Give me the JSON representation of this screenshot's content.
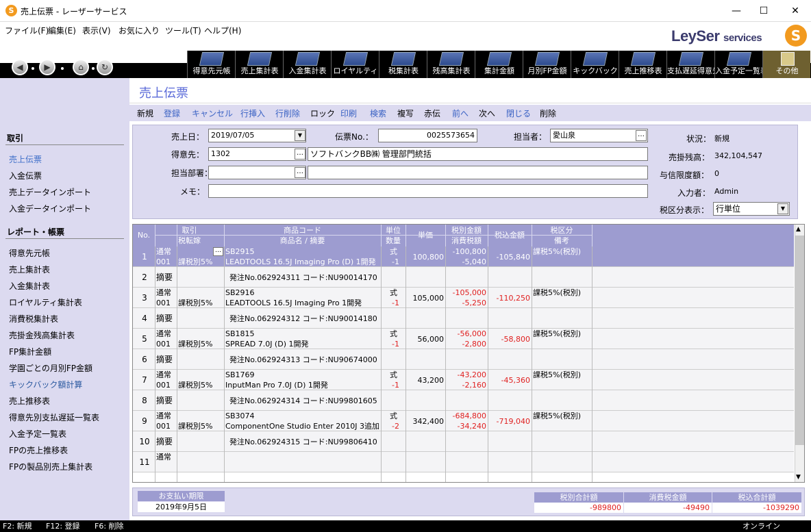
{
  "window": {
    "title": "売上伝票 - レーザーサービス",
    "app_icon": "S",
    "min": "—",
    "max": "☐",
    "close": "✕"
  },
  "menu": [
    "ファイル(F)",
    "編集(E)",
    "表示(V)",
    "お気に入り",
    "ツール(T)",
    "ヘルプ(H)"
  ],
  "logo": {
    "text": "LeySer",
    "suffix": "services",
    "mark": "S"
  },
  "nav": {
    "back": "◀",
    "forward": "▶",
    "home": "⌂",
    "refresh": "↻"
  },
  "toolbar": [
    "得意先元帳",
    "売上集計表",
    "入金集計表",
    "ロイヤルティ",
    "税集計表",
    "残高集計表",
    "集計金額",
    "月別FP金額",
    "キックバック",
    "売上推移表",
    "支払遅延得意先一覧",
    "入金予定一覧表",
    "その他"
  ],
  "sidebar": {
    "section1": "取引",
    "items1": [
      "売上伝票",
      "入金伝票",
      "売上データインポート",
      "入金データインポート"
    ],
    "section2": "レポート・帳票",
    "items2": [
      "得意先元帳",
      "売上集計表",
      "入金集計表",
      "ロイヤルティ集計表",
      "消費税集計表",
      "売掛金残高集計表",
      "FP集計金額",
      "学園ごとの月別FP金額",
      "キックバック額計算",
      "売上推移表",
      "得意先別支払遅延一覧表",
      "入金予定一覧表",
      "FPの売上推移表",
      "FPの製品別売上集計表"
    ]
  },
  "page_title": "売上伝票",
  "actions": [
    "新規",
    "登録",
    "キャンセル",
    "行挿入",
    "行削除",
    "ロック",
    "印刷",
    "検索",
    "複写",
    "赤伝",
    "前へ",
    "次へ",
    "閉じる",
    "削除"
  ],
  "form": {
    "sales_date_label": "売上日：",
    "sales_date": "2019/07/05",
    "slip_no_label": "伝票No.：",
    "slip_no": "0025573654",
    "staff_label": "担当者：",
    "staff": "愛山泉",
    "customer_label": "得意先：",
    "customer_code": "1302",
    "customer_name": "ソフトバンクBB㈱ 管理部門統括",
    "dept_label": "担当部署：",
    "dept_code": "",
    "dept_name": "",
    "memo_label": "メモ：",
    "memo": "",
    "status_label": "状況：",
    "status": "新規",
    "balance_label": "売掛残高：",
    "balance": "342,104,547",
    "credit_label": "与信限度額：",
    "credit": "0",
    "entered_by_label": "入力者：",
    "entered_by": "Admin",
    "tax_display_label": "税区分表示：",
    "tax_display": "行単位"
  },
  "grid": {
    "headers": {
      "no": "No.",
      "torihiki": "取引",
      "tenkan": "税転嫁",
      "code": "商品コード",
      "name": "商品名 / 摘要",
      "unit": "単位",
      "qty": "数量",
      "price": "単価",
      "excl": "税別金額",
      "tax": "消費税額",
      "incl": "税込金額",
      "taxcat": "税区分",
      "note": "備考"
    },
    "rows": [
      {
        "no": "1",
        "type": "item",
        "torihiki": "通常",
        "tcode": "001",
        "tenkan": "課税別5%",
        "code": "SB2915",
        "name": "LEADTOOLS 16.5J Imaging Pro (D) 1開発",
        "unit": "式",
        "qty": "-1",
        "price": "100,800",
        "excl": "-100,800",
        "tax": "-5,040",
        "incl": "-105,840",
        "taxcat": "課税5%(税別)"
      },
      {
        "no": "2",
        "type": "memo",
        "label": "摘要",
        "text": "発注No.062924311 コード:NU90014170"
      },
      {
        "no": "3",
        "type": "item",
        "torihiki": "通常",
        "tcode": "001",
        "tenkan": "課税別5%",
        "code": "SB2916",
        "name": "LEADTOOLS 16.5J Imaging Pro 1開発",
        "unit": "式",
        "qty": "-1",
        "price": "105,000",
        "excl": "-105,000",
        "tax": "-5,250",
        "incl": "-110,250",
        "taxcat": "課税5%(税別)"
      },
      {
        "no": "4",
        "type": "memo",
        "label": "摘要",
        "text": "発注No.062924312 コード:NU90014180"
      },
      {
        "no": "5",
        "type": "item",
        "torihiki": "通常",
        "tcode": "001",
        "tenkan": "課税別5%",
        "code": "SB1815",
        "name": "SPREAD 7.0J (D) 1開発",
        "unit": "式",
        "qty": "-1",
        "price": "56,000",
        "excl": "-56,000",
        "tax": "-2,800",
        "incl": "-58,800",
        "taxcat": "課税5%(税別)"
      },
      {
        "no": "6",
        "type": "memo",
        "label": "摘要",
        "text": "発注No.062924313 コード:NU90674000"
      },
      {
        "no": "7",
        "type": "item",
        "torihiki": "通常",
        "tcode": "001",
        "tenkan": "課税別5%",
        "code": "SB1769",
        "name": "InputMan Pro 7.0J (D) 1開発",
        "unit": "式",
        "qty": "-1",
        "price": "43,200",
        "excl": "-43,200",
        "tax": "-2,160",
        "incl": "-45,360",
        "taxcat": "課税5%(税別)"
      },
      {
        "no": "8",
        "type": "memo",
        "label": "摘要",
        "text": "発注No.062924314 コード:NU99801605"
      },
      {
        "no": "9",
        "type": "item",
        "torihiki": "通常",
        "tcode": "001",
        "tenkan": "課税別5%",
        "code": "SB3074",
        "name": "ComponentOne Studio Enter 2010J 3追加",
        "unit": "式",
        "qty": "-2",
        "price": "342,400",
        "excl": "-684,800",
        "tax": "-34,240",
        "incl": "-719,040",
        "taxcat": "課税5%(税別)"
      },
      {
        "no": "10",
        "type": "memo",
        "label": "摘要",
        "text": "発注No.062924315 コード:NU99806410"
      },
      {
        "no": "11",
        "type": "new",
        "torihiki": "通常"
      }
    ]
  },
  "totals": {
    "due_label": "お支払い期限",
    "due": "2019年9月5日",
    "excl_label": "税別合計額",
    "excl": "-989800",
    "tax_label": "消費税金額",
    "tax": "-49490",
    "incl_label": "税込合計額",
    "incl": "-1039290"
  },
  "status": {
    "f2": "F2: 新規",
    "f12": "F12: 登録",
    "f6": "F6: 削除",
    "online": "オンライン"
  },
  "colors": {
    "accent": "#9d9cd0",
    "panel": "#dcdaf0",
    "negative": "#e02020",
    "title": "#5a6ad8"
  }
}
